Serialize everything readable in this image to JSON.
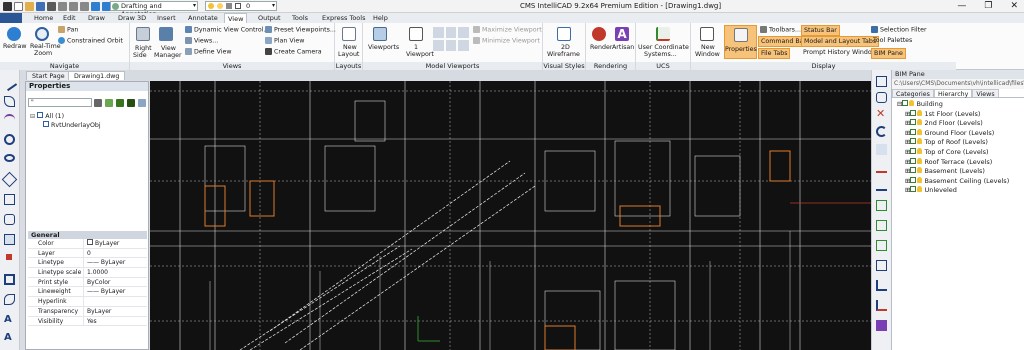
{
  "window": {
    "title": "CMS IntelliCAD 9.2x64 Premium Edition  -  [Drawing1.dwg]",
    "workspace": "Drafting and Annotation",
    "layer_value": "0",
    "controls": [
      "—",
      "❐",
      "✕"
    ]
  },
  "menu": [
    "Home",
    "Edit",
    "Draw",
    "Draw 3D",
    "Insert",
    "Annotate",
    "View",
    "Output",
    "Tools",
    "Express Tools",
    "Help"
  ],
  "menu_active": "View",
  "ribbon": {
    "navigate": {
      "label": "Navigate",
      "redraw": "Redraw",
      "realtime": "Real-Time",
      "zoom": "Zoom",
      "pan": "Pan",
      "orbit": "Constrained Orbit"
    },
    "views": {
      "label": "Views",
      "right": "Right",
      "side": "Side",
      "view_manager": "View",
      "view_manager2": "Manager",
      "dvc": "Dynamic View Control...",
      "views": "Views...",
      "define": "Define View",
      "preset": "Preset Viewpoints...",
      "plan": "Plan View",
      "camera": "Create Camera"
    },
    "layouts": {
      "label": "Layouts",
      "new": "New",
      "layout": "Layout"
    },
    "model_viewports": {
      "label": "Model Viewports",
      "viewports": "Viewports",
      "one": "1",
      "viewport": "Viewport",
      "maximize": "Maximize Viewport",
      "minimize": "Minimize Viewport"
    },
    "visual_styles": {
      "label": "Visual Styles",
      "wire": "2D",
      "wire2": "Wireframe"
    },
    "rendering": {
      "label": "Rendering",
      "render": "Render",
      "artisan": "Artisan"
    },
    "ucs": {
      "label": "UCS",
      "ucs": "User Coordinate",
      "ucs2": "Systems..."
    },
    "display": {
      "label": "Display",
      "new_window": "New",
      "window": "Window",
      "properties": "Properties",
      "toolbars": "Toolbars...",
      "command_bar": "Command Bar",
      "file_tabs": "File Tabs",
      "status_bar": "Status Bar",
      "model_tabs": "Model and Layout Tabs",
      "prompt": "Prompt History Window",
      "selection": "Selection Filter",
      "palettes": "Tool Palettes",
      "bim_pane": "BIM Pane"
    }
  },
  "doc_tabs": [
    "Start Page",
    "Drawing1.dwg"
  ],
  "properties": {
    "header": "Properties",
    "filter": "\"",
    "tree": {
      "all": "All (1)",
      "obj": "RvtUnderlayObj"
    },
    "general_header": "General",
    "rows": [
      {
        "k": "Color",
        "v": "ByLayer"
      },
      {
        "k": "Layer",
        "v": "0"
      },
      {
        "k": "Linetype",
        "v": "—— ByLayer"
      },
      {
        "k": "Linetype scale",
        "v": "1.0000"
      },
      {
        "k": "Print style",
        "v": "ByColor"
      },
      {
        "k": "Lineweight",
        "v": "—— ByLayer"
      },
      {
        "k": "Hyperlink",
        "v": ""
      },
      {
        "k": "Transparency",
        "v": "ByLayer"
      },
      {
        "k": "Visibility",
        "v": "Yes"
      }
    ]
  },
  "bim": {
    "header": "BIM Pane",
    "path": "C:\\Users\\CMS\\Documents\\vh\\intellicad\\files\\",
    "tabs": [
      "Categories",
      "Hierarchy",
      "Views"
    ],
    "active_tab": "Hierarchy",
    "root": "Building",
    "items": [
      "1st Floor (Levels)",
      "2nd Floor (Levels)",
      "Ground Floor (Levels)",
      "Top of Roof (Levels)",
      "Top of Core (Levels)",
      "Roof Terrace (Levels)",
      "Basement (Levels)",
      "Basement Ceiling (Levels)",
      "Unleveled"
    ]
  },
  "colors": {
    "accent": "#f7c27a",
    "drawing_bg": "#111111",
    "line": "#e8e8e8",
    "highlight": "#e07b2a"
  }
}
